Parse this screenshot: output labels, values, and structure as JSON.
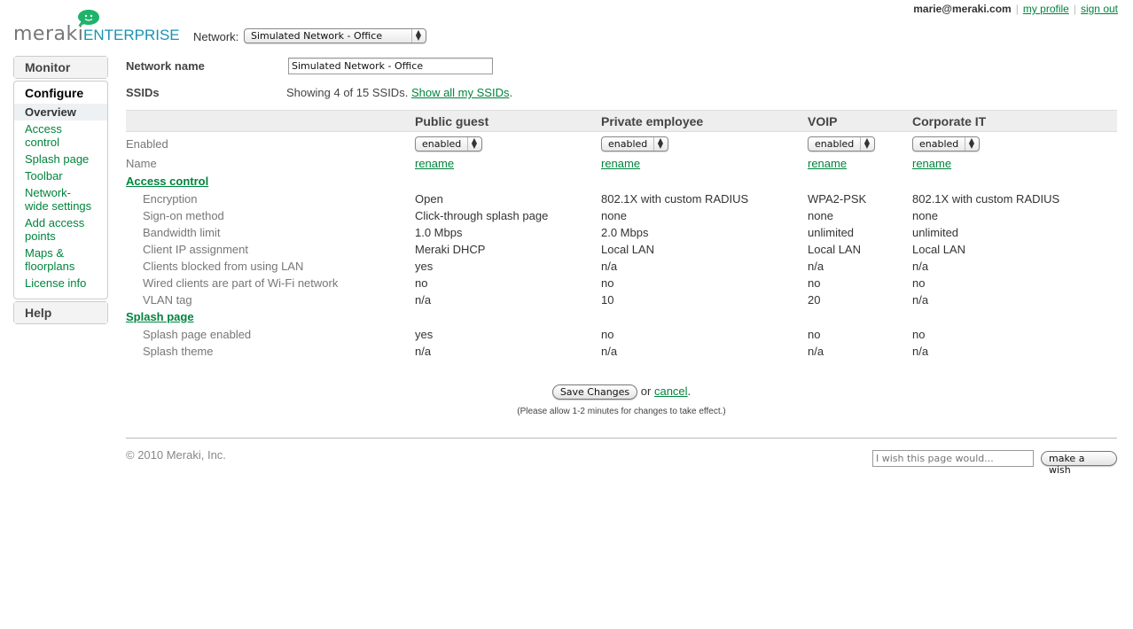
{
  "brand": {
    "name": "meraki",
    "product": "ENTERPRISE",
    "accent": "#00843d",
    "logo_icon": "smiley-speech-bubble-icon"
  },
  "header": {
    "network_label": "Network:",
    "network_selected": "Simulated Network - Office",
    "user": "marie@meraki.com",
    "links": [
      "my profile",
      "sign out"
    ]
  },
  "sidebar": {
    "monitor": "Monitor",
    "configure": "Configure",
    "items": [
      {
        "label": "Overview",
        "active": true
      },
      {
        "label": "Access control"
      },
      {
        "label": "Splash page"
      },
      {
        "label": "Toolbar"
      },
      {
        "label": "Network-wide settings"
      },
      {
        "label": "Add access points"
      },
      {
        "label": "Maps & floorplans"
      },
      {
        "label": "License info"
      }
    ],
    "help": "Help"
  },
  "main": {
    "network_name_label": "Network name",
    "network_name_value": "Simulated Network - Office",
    "ssids_label": "SSIDs",
    "ssids_info": "Showing 4 of 15 SSIDs.",
    "ssids_link": "Show all my SSIDs",
    "table": {
      "columns": [
        "Public guest",
        "Private employee",
        "VOIP",
        "Corporate IT"
      ],
      "enabled_label": "Enabled",
      "enabled_values": [
        "enabled",
        "enabled",
        "enabled",
        "enabled"
      ],
      "name_label": "Name",
      "rename_label": "rename",
      "sections": [
        {
          "title": "Access control",
          "rows": [
            {
              "label": "Encryption",
              "values": [
                "Open",
                "802.1X with custom RADIUS",
                "WPA2-PSK",
                "802.1X with custom RADIUS"
              ]
            },
            {
              "label": "Sign-on method",
              "values": [
                "Click-through splash page",
                "none",
                "none",
                "none"
              ]
            },
            {
              "label": "Bandwidth limit",
              "values": [
                "1.0 Mbps",
                "2.0 Mbps",
                "unlimited",
                "unlimited"
              ]
            },
            {
              "label": "Client IP assignment",
              "values": [
                "Meraki DHCP",
                "Local LAN",
                "Local LAN",
                "Local LAN"
              ]
            },
            {
              "label": "Clients blocked from using LAN",
              "values": [
                "yes",
                "n/a",
                "n/a",
                "n/a"
              ]
            },
            {
              "label": "Wired clients are part of Wi-Fi network",
              "values": [
                "no",
                "no",
                "no",
                "no"
              ]
            },
            {
              "label": "VLAN tag",
              "values": [
                "n/a",
                "10",
                "20",
                "n/a"
              ]
            }
          ]
        },
        {
          "title": "Splash page",
          "rows": [
            {
              "label": "Splash page enabled",
              "values": [
                "yes",
                "no",
                "no",
                "no"
              ]
            },
            {
              "label": "Splash theme",
              "values": [
                "n/a",
                "n/a",
                "n/a",
                "n/a"
              ]
            }
          ]
        }
      ]
    },
    "save_label": "Save Changes",
    "or_text": "or",
    "cancel_label": "cancel",
    "note": "(Please allow 1-2 minutes for changes to take effect.)"
  },
  "footer": {
    "copyright": "© 2010 Meraki, Inc.",
    "wish_placeholder": "I wish this page would...",
    "wish_button": "make a wish"
  }
}
